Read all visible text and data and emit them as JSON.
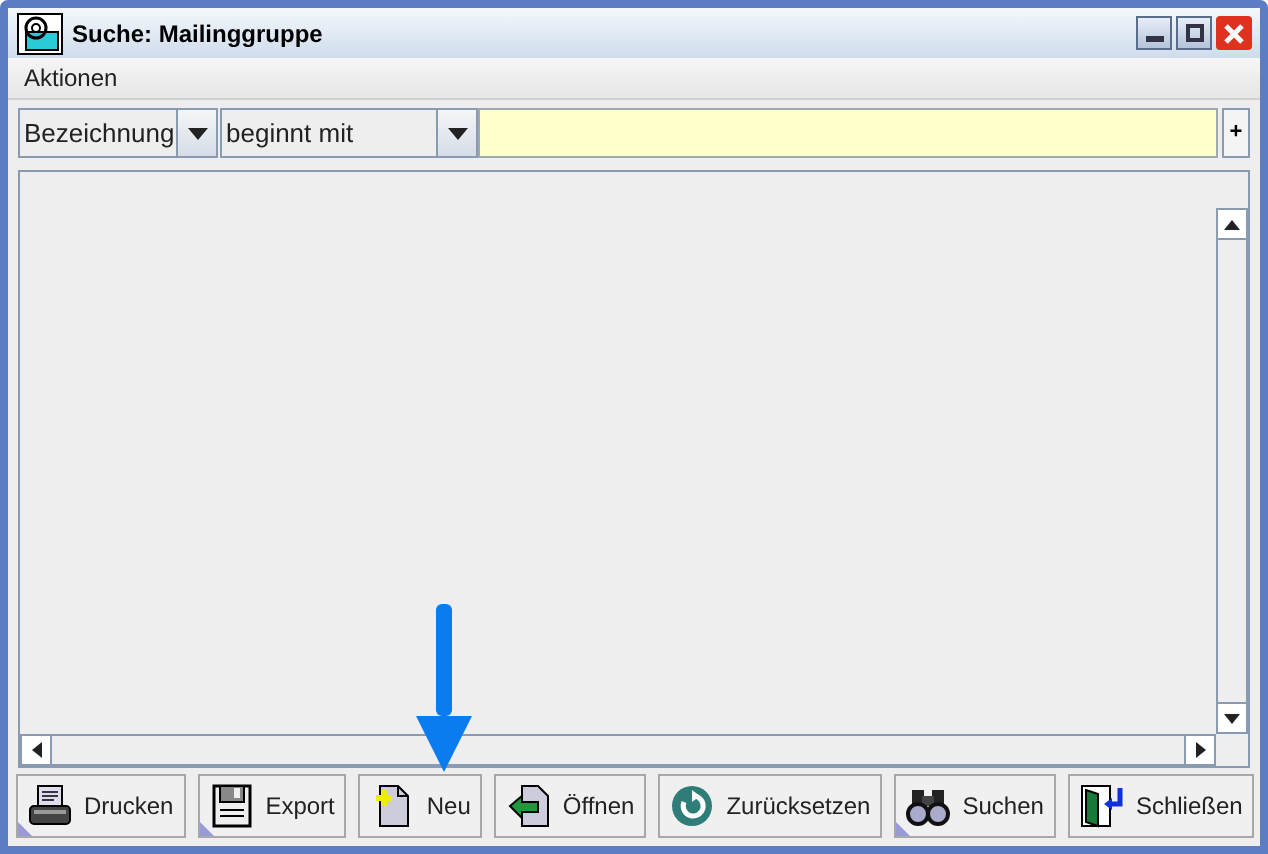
{
  "window": {
    "title": "Suche: Mailinggruppe"
  },
  "menu": [
    "Aktionen"
  ],
  "filter": {
    "field": "Bezeichnung",
    "operator": "beginnt mit",
    "add_button": "+"
  },
  "buttons": [
    {
      "label": "Drucken",
      "has_menu": true
    },
    {
      "label": "Export",
      "has_menu": true
    },
    {
      "label": "Neu",
      "has_menu": false
    },
    {
      "label": "Öffnen",
      "has_menu": false
    },
    {
      "label": "Zurücksetzen",
      "has_menu": false
    },
    {
      "label": "Suchen",
      "has_menu": true
    },
    {
      "label": "Schließen",
      "has_menu": false
    }
  ]
}
